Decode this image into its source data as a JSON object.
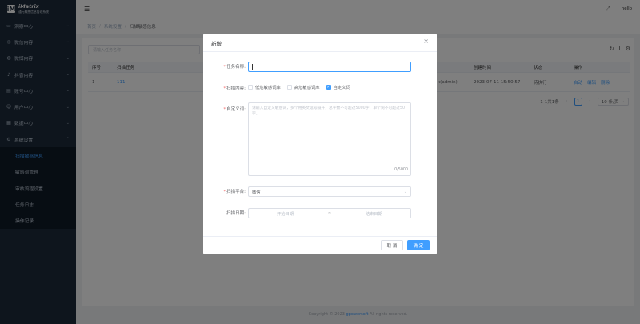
{
  "logo": {
    "mark": "iM",
    "name": "iMatrix",
    "subtitle": "通元敏感信息管理系统"
  },
  "sidebar": {
    "items": [
      {
        "label": "洞察中心",
        "icon": "monitor-icon"
      },
      {
        "label": "微信内容",
        "icon": "chat-icon"
      },
      {
        "label": "微博内容",
        "icon": "weibo-icon"
      },
      {
        "label": "抖音内容",
        "icon": "video-icon"
      },
      {
        "label": "账号中心",
        "icon": "account-icon"
      },
      {
        "label": "用户中心",
        "icon": "user-icon"
      },
      {
        "label": "数据中心",
        "icon": "data-icon"
      },
      {
        "label": "系统设置",
        "icon": "gear-icon"
      }
    ],
    "submenu": [
      {
        "label": "扫描敏感信息"
      },
      {
        "label": "敏感词管理"
      },
      {
        "label": "审核流程设置"
      },
      {
        "label": "任务日志"
      },
      {
        "label": "操作记录"
      }
    ]
  },
  "header": {
    "user": "hello"
  },
  "breadcrumb": {
    "home": "首页",
    "level1": "系统设置",
    "current": "扫描敏感信息"
  },
  "search": {
    "placeholder": "请输入任务名称"
  },
  "table": {
    "headers": [
      "序号",
      "扫描任务",
      "",
      "",
      "创建时间",
      "状态",
      "操作"
    ],
    "rows": [
      {
        "index": "1",
        "task": "111",
        "creator": "k(admin)",
        "created": "2023-07-11 15:50:57",
        "status": "待执行",
        "actions": [
          "启动",
          "编辑",
          "删除"
        ]
      }
    ]
  },
  "pagination": {
    "total": "1-1共1条",
    "current": "1",
    "size": "10 条/页"
  },
  "footer": {
    "prefix": "Copyright © 2023 ",
    "brand": "gpowersoft",
    "suffix": " All rights reserved."
  },
  "dialog": {
    "title": "新增",
    "name_label": "任务名称:",
    "content_label": "扫描内容:",
    "options": [
      {
        "label": "低危敏感词库",
        "checked": false
      },
      {
        "label": "高危敏感词库",
        "checked": false
      },
      {
        "label": "自定义词",
        "checked": true
      }
    ],
    "custom_label": "自定义词:",
    "custom_placeholder": "请输入自定义敏感词，多个用英文逗号隔开，总字数不可超过5000字，单个词不可超过50字。",
    "custom_count": "0/5000",
    "platform_label": "扫描平台:",
    "platform_value": "微信",
    "date_label": "扫描日期:",
    "date_start": "开始日期",
    "date_sep": "~",
    "date_end": "结束日期",
    "cancel": "取 消",
    "ok": "确 定"
  }
}
